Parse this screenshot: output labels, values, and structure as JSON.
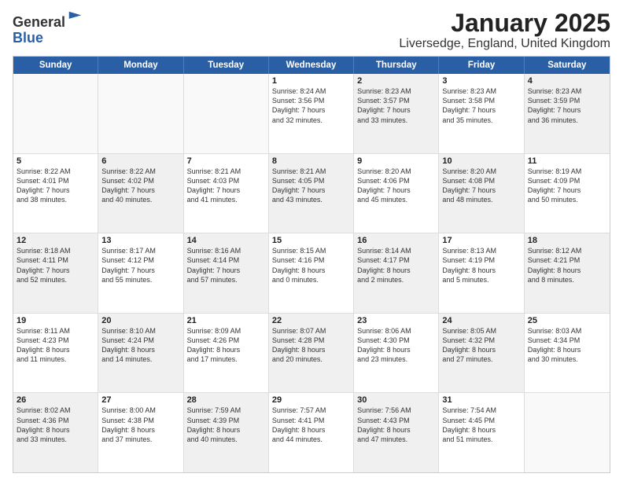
{
  "logo": {
    "general": "General",
    "blue": "Blue"
  },
  "title": "January 2025",
  "subtitle": "Liversedge, England, United Kingdom",
  "weekdays": [
    "Sunday",
    "Monday",
    "Tuesday",
    "Wednesday",
    "Thursday",
    "Friday",
    "Saturday"
  ],
  "rows": [
    [
      {
        "day": "",
        "text": "",
        "shaded": false,
        "empty": true
      },
      {
        "day": "",
        "text": "",
        "shaded": false,
        "empty": true
      },
      {
        "day": "",
        "text": "",
        "shaded": false,
        "empty": true
      },
      {
        "day": "1",
        "text": "Sunrise: 8:24 AM\nSunset: 3:56 PM\nDaylight: 7 hours\nand 32 minutes.",
        "shaded": false,
        "empty": false
      },
      {
        "day": "2",
        "text": "Sunrise: 8:23 AM\nSunset: 3:57 PM\nDaylight: 7 hours\nand 33 minutes.",
        "shaded": true,
        "empty": false
      },
      {
        "day": "3",
        "text": "Sunrise: 8:23 AM\nSunset: 3:58 PM\nDaylight: 7 hours\nand 35 minutes.",
        "shaded": false,
        "empty": false
      },
      {
        "day": "4",
        "text": "Sunrise: 8:23 AM\nSunset: 3:59 PM\nDaylight: 7 hours\nand 36 minutes.",
        "shaded": true,
        "empty": false
      }
    ],
    [
      {
        "day": "5",
        "text": "Sunrise: 8:22 AM\nSunset: 4:01 PM\nDaylight: 7 hours\nand 38 minutes.",
        "shaded": false,
        "empty": false
      },
      {
        "day": "6",
        "text": "Sunrise: 8:22 AM\nSunset: 4:02 PM\nDaylight: 7 hours\nand 40 minutes.",
        "shaded": true,
        "empty": false
      },
      {
        "day": "7",
        "text": "Sunrise: 8:21 AM\nSunset: 4:03 PM\nDaylight: 7 hours\nand 41 minutes.",
        "shaded": false,
        "empty": false
      },
      {
        "day": "8",
        "text": "Sunrise: 8:21 AM\nSunset: 4:05 PM\nDaylight: 7 hours\nand 43 minutes.",
        "shaded": true,
        "empty": false
      },
      {
        "day": "9",
        "text": "Sunrise: 8:20 AM\nSunset: 4:06 PM\nDaylight: 7 hours\nand 45 minutes.",
        "shaded": false,
        "empty": false
      },
      {
        "day": "10",
        "text": "Sunrise: 8:20 AM\nSunset: 4:08 PM\nDaylight: 7 hours\nand 48 minutes.",
        "shaded": true,
        "empty": false
      },
      {
        "day": "11",
        "text": "Sunrise: 8:19 AM\nSunset: 4:09 PM\nDaylight: 7 hours\nand 50 minutes.",
        "shaded": false,
        "empty": false
      }
    ],
    [
      {
        "day": "12",
        "text": "Sunrise: 8:18 AM\nSunset: 4:11 PM\nDaylight: 7 hours\nand 52 minutes.",
        "shaded": true,
        "empty": false
      },
      {
        "day": "13",
        "text": "Sunrise: 8:17 AM\nSunset: 4:12 PM\nDaylight: 7 hours\nand 55 minutes.",
        "shaded": false,
        "empty": false
      },
      {
        "day": "14",
        "text": "Sunrise: 8:16 AM\nSunset: 4:14 PM\nDaylight: 7 hours\nand 57 minutes.",
        "shaded": true,
        "empty": false
      },
      {
        "day": "15",
        "text": "Sunrise: 8:15 AM\nSunset: 4:16 PM\nDaylight: 8 hours\nand 0 minutes.",
        "shaded": false,
        "empty": false
      },
      {
        "day": "16",
        "text": "Sunrise: 8:14 AM\nSunset: 4:17 PM\nDaylight: 8 hours\nand 2 minutes.",
        "shaded": true,
        "empty": false
      },
      {
        "day": "17",
        "text": "Sunrise: 8:13 AM\nSunset: 4:19 PM\nDaylight: 8 hours\nand 5 minutes.",
        "shaded": false,
        "empty": false
      },
      {
        "day": "18",
        "text": "Sunrise: 8:12 AM\nSunset: 4:21 PM\nDaylight: 8 hours\nand 8 minutes.",
        "shaded": true,
        "empty": false
      }
    ],
    [
      {
        "day": "19",
        "text": "Sunrise: 8:11 AM\nSunset: 4:23 PM\nDaylight: 8 hours\nand 11 minutes.",
        "shaded": false,
        "empty": false
      },
      {
        "day": "20",
        "text": "Sunrise: 8:10 AM\nSunset: 4:24 PM\nDaylight: 8 hours\nand 14 minutes.",
        "shaded": true,
        "empty": false
      },
      {
        "day": "21",
        "text": "Sunrise: 8:09 AM\nSunset: 4:26 PM\nDaylight: 8 hours\nand 17 minutes.",
        "shaded": false,
        "empty": false
      },
      {
        "day": "22",
        "text": "Sunrise: 8:07 AM\nSunset: 4:28 PM\nDaylight: 8 hours\nand 20 minutes.",
        "shaded": true,
        "empty": false
      },
      {
        "day": "23",
        "text": "Sunrise: 8:06 AM\nSunset: 4:30 PM\nDaylight: 8 hours\nand 23 minutes.",
        "shaded": false,
        "empty": false
      },
      {
        "day": "24",
        "text": "Sunrise: 8:05 AM\nSunset: 4:32 PM\nDaylight: 8 hours\nand 27 minutes.",
        "shaded": true,
        "empty": false
      },
      {
        "day": "25",
        "text": "Sunrise: 8:03 AM\nSunset: 4:34 PM\nDaylight: 8 hours\nand 30 minutes.",
        "shaded": false,
        "empty": false
      }
    ],
    [
      {
        "day": "26",
        "text": "Sunrise: 8:02 AM\nSunset: 4:36 PM\nDaylight: 8 hours\nand 33 minutes.",
        "shaded": true,
        "empty": false
      },
      {
        "day": "27",
        "text": "Sunrise: 8:00 AM\nSunset: 4:38 PM\nDaylight: 8 hours\nand 37 minutes.",
        "shaded": false,
        "empty": false
      },
      {
        "day": "28",
        "text": "Sunrise: 7:59 AM\nSunset: 4:39 PM\nDaylight: 8 hours\nand 40 minutes.",
        "shaded": true,
        "empty": false
      },
      {
        "day": "29",
        "text": "Sunrise: 7:57 AM\nSunset: 4:41 PM\nDaylight: 8 hours\nand 44 minutes.",
        "shaded": false,
        "empty": false
      },
      {
        "day": "30",
        "text": "Sunrise: 7:56 AM\nSunset: 4:43 PM\nDaylight: 8 hours\nand 47 minutes.",
        "shaded": true,
        "empty": false
      },
      {
        "day": "31",
        "text": "Sunrise: 7:54 AM\nSunset: 4:45 PM\nDaylight: 8 hours\nand 51 minutes.",
        "shaded": false,
        "empty": false
      },
      {
        "day": "",
        "text": "",
        "shaded": true,
        "empty": true
      }
    ]
  ]
}
